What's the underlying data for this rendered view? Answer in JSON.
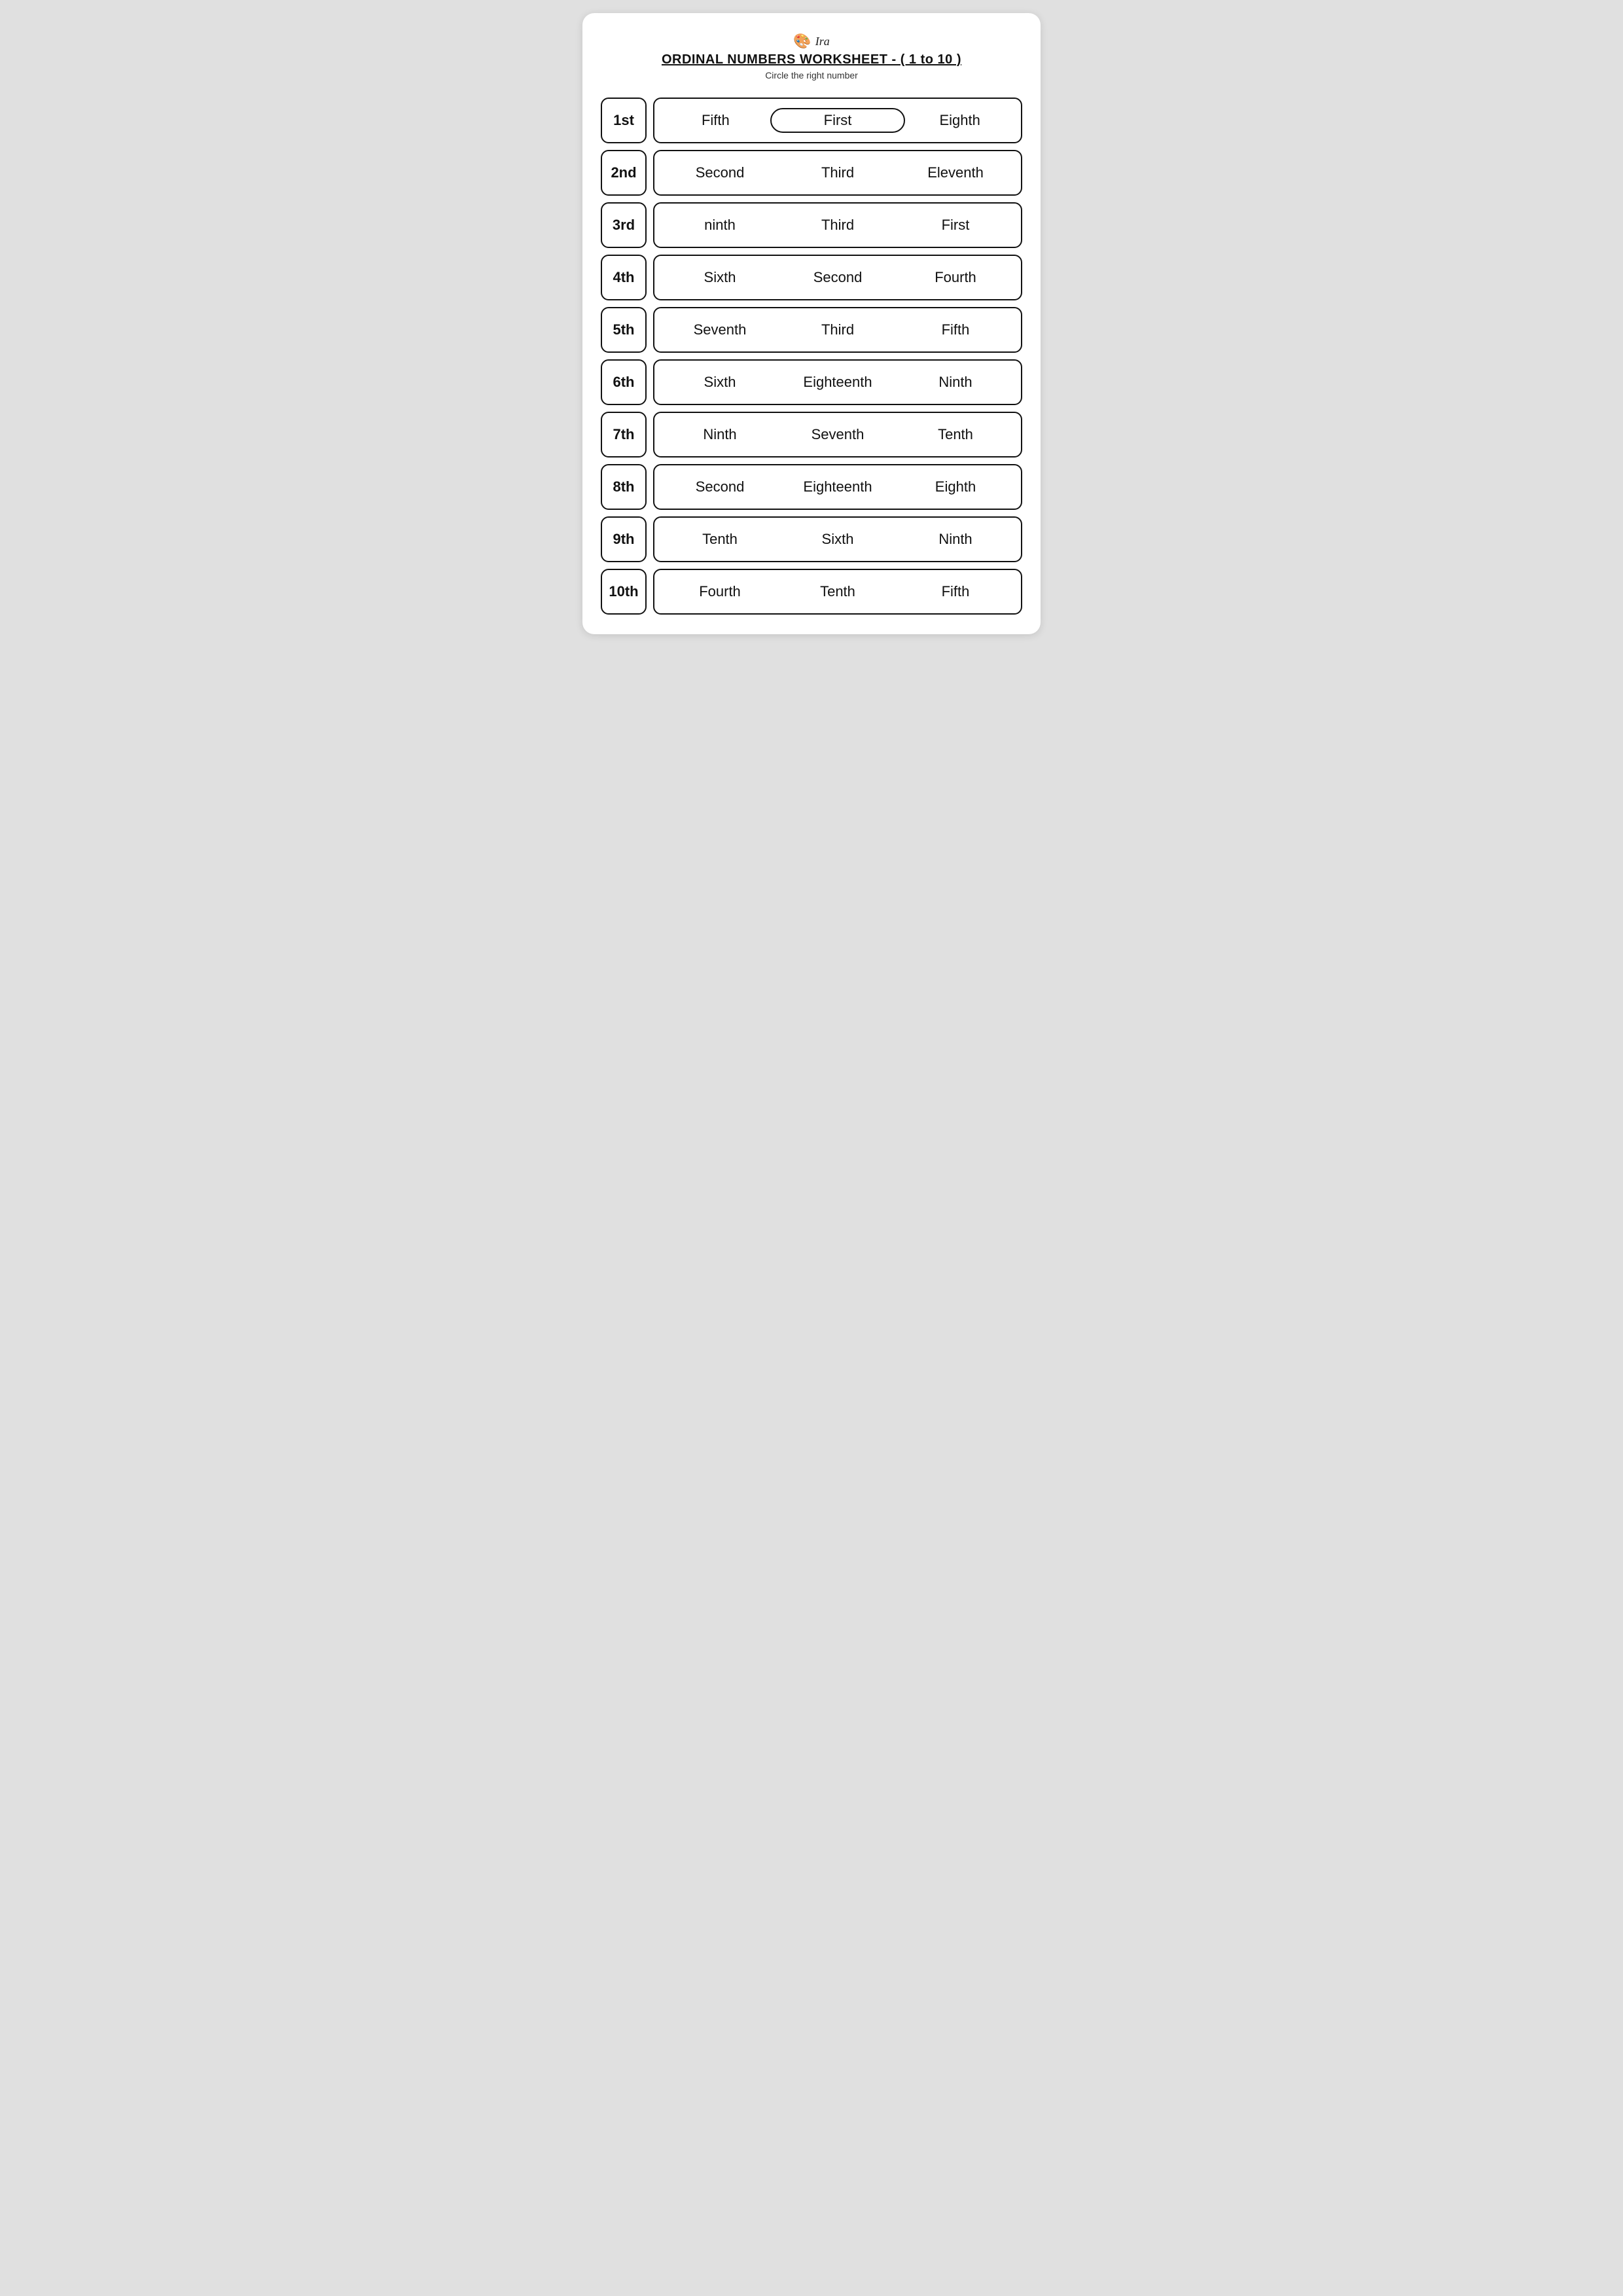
{
  "header": {
    "logo_icon": "🎨",
    "logo_text": "Ira",
    "title": "ORDINAL NUMBERS WORKSHEET - ( 1 to 10 )",
    "subtitle": "Circle the right number"
  },
  "rows": [
    {
      "ordinal": "1st",
      "options": [
        "Fifth",
        "First",
        "Eighth"
      ],
      "circled": 1
    },
    {
      "ordinal": "2nd",
      "options": [
        "Second",
        "Third",
        "Eleventh"
      ],
      "circled": -1
    },
    {
      "ordinal": "3rd",
      "options": [
        "ninth",
        "Third",
        "First"
      ],
      "circled": -1
    },
    {
      "ordinal": "4th",
      "options": [
        "Sixth",
        "Second",
        "Fourth"
      ],
      "circled": -1
    },
    {
      "ordinal": "5th",
      "options": [
        "Seventh",
        "Third",
        "Fifth"
      ],
      "circled": -1
    },
    {
      "ordinal": "6th",
      "options": [
        "Sixth",
        "Eighteenth",
        "Ninth"
      ],
      "circled": -1
    },
    {
      "ordinal": "7th",
      "options": [
        "Ninth",
        "Seventh",
        "Tenth"
      ],
      "circled": -1
    },
    {
      "ordinal": "8th",
      "options": [
        "Second",
        "Eighteenth",
        "Eighth"
      ],
      "circled": -1
    },
    {
      "ordinal": "9th",
      "options": [
        "Tenth",
        "Sixth",
        "Ninth"
      ],
      "circled": -1
    },
    {
      "ordinal": "10th",
      "options": [
        "Fourth",
        "Tenth",
        "Fifth"
      ],
      "circled": -1
    }
  ]
}
